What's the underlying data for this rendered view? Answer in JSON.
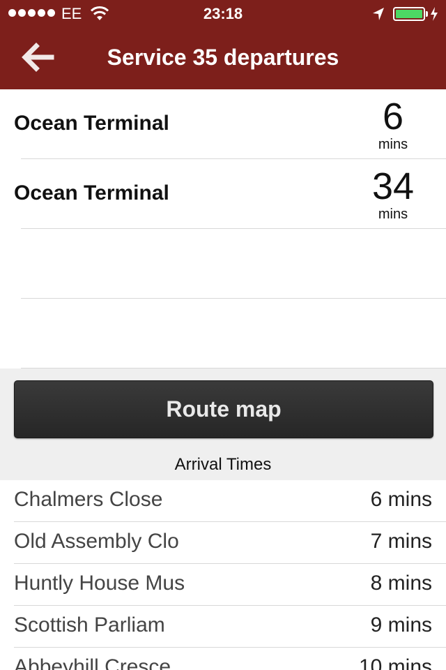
{
  "status_bar": {
    "signal_bars": 5,
    "carrier": "EE",
    "time": "23:18",
    "battery_level": 1.0,
    "battery_color": "#4cd964"
  },
  "nav": {
    "title": "Service 35 departures",
    "back_icon": "back-arrow-icon",
    "background": "#7d1f1b"
  },
  "departures": [
    {
      "destination": "Ocean Terminal",
      "mins": "6",
      "unit": "mins"
    },
    {
      "destination": "Ocean Terminal",
      "mins": "34",
      "unit": "mins"
    },
    {
      "destination": "",
      "mins": "",
      "unit": ""
    },
    {
      "destination": "",
      "mins": "",
      "unit": ""
    }
  ],
  "route_map_button": "Route map",
  "arrival_heading": "Arrival Times",
  "arrivals": [
    {
      "stop": "Chalmers Close",
      "time": "6 mins"
    },
    {
      "stop": "Old Assembly Clo",
      "time": "7 mins"
    },
    {
      "stop": "Huntly House Mus",
      "time": "8 mins"
    },
    {
      "stop": "Scottish Parliam",
      "time": "9 mins"
    },
    {
      "stop": "Abbeyhill Cresce",
      "time": "10 mins"
    }
  ]
}
